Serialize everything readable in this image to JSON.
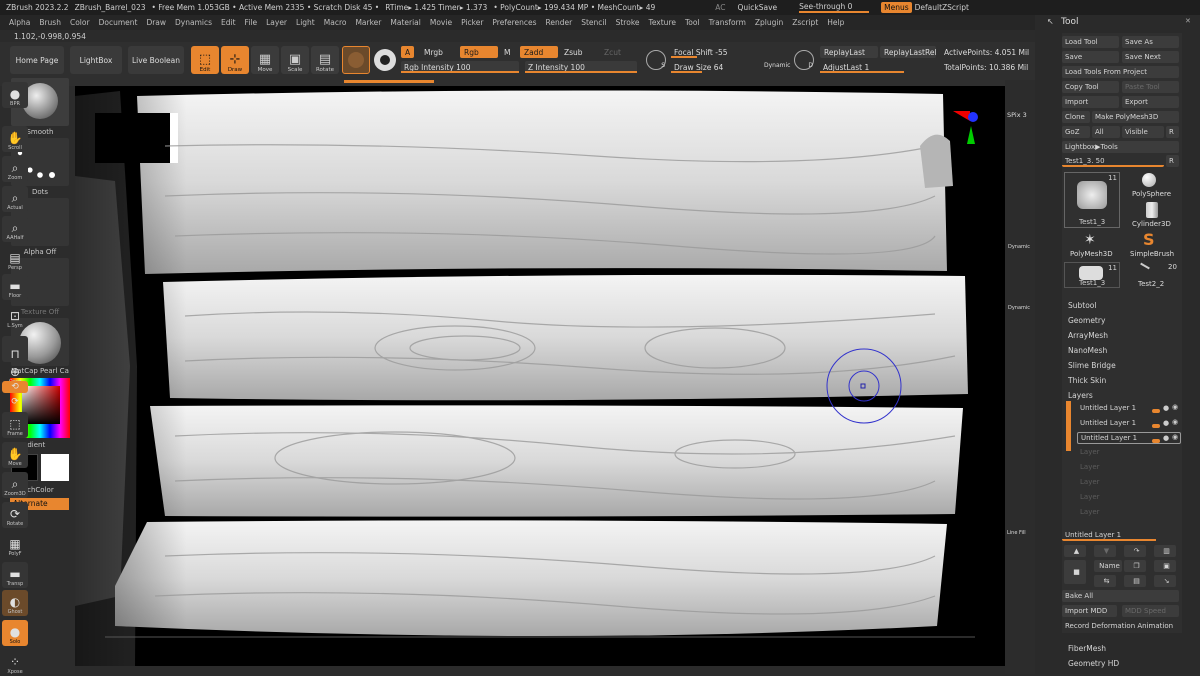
{
  "titlebar": {
    "app": "ZBrush 2023.2.2",
    "file": "ZBrush_Barrel_023",
    "mem": "• Free Mem 1.053GB • Active Mem 2335 • Scratch Disk 45 •",
    "rtime": "RTime▸ 1.425 Timer▸ 1.373",
    "poly": "• PolyCount▸ 199.434 MP • MeshCount▸ 49",
    "ac": "AC",
    "quicksave": "QuickSave",
    "see_through": "See-through  0",
    "menus": "Menus",
    "script": "DefaultZScript"
  },
  "menus": [
    "Alpha",
    "Brush",
    "Color",
    "Document",
    "Draw",
    "Dynamics",
    "Edit",
    "File",
    "Layer",
    "Light",
    "Macro",
    "Marker",
    "Material",
    "Movie",
    "Picker",
    "Preferences",
    "Render",
    "Stencil",
    "Stroke",
    "Texture",
    "Tool",
    "Transform",
    "Zplugin",
    "Zscript",
    "Help"
  ],
  "coords": "1.102,-0.998,0.954",
  "shelf": {
    "home": "Home Page",
    "lightbox": "LightBox",
    "liveboolean": "Live Boolean",
    "edit": "Edit",
    "draw": "Draw",
    "move": "Move",
    "scale": "Scale",
    "rotate": "Rotate",
    "a": "A",
    "mrgb": "Mrgb",
    "rgb": "Rgb",
    "m": "M",
    "zadd": "Zadd",
    "zsub": "Zsub",
    "zcut": "Zcut",
    "rgb_intensity": "Rgb Intensity 100",
    "z_intensity": "Z Intensity 100",
    "focal_shift": "Focal Shift -55",
    "draw_size": "Draw Size 64",
    "dynamic": "Dynamic",
    "replay_last": "ReplayLast",
    "replay_last_rel": "ReplayLastRel",
    "adjust_last": "AdjustLast 1",
    "active_points": "ActivePoints: 4.051 Mil",
    "total_points": "TotalPoints: 10.386 Mil",
    "s_label": "S",
    "d_label": "D"
  },
  "leftpanel": {
    "smooth": "Smooth",
    "dots": "Dots",
    "alpha": "Alpha Off",
    "texture": "Texture Off",
    "matcap": "MatCap Pearl Ca",
    "gradient": "Gradient",
    "switchcolor": "SwitchColor",
    "alternate": "Alternate"
  },
  "rightshelf": {
    "bpr": "BPR",
    "spix": "SPix 3",
    "scroll": "Scroll",
    "zoom": "Zoom",
    "actual": "Actual",
    "aahalf": "AAHalf",
    "dynamic": "Dynamic",
    "persp": "Persp",
    "floor": "Floor",
    "dynamic2": "Dynamic",
    "l_sym": "L.Sym",
    "xyz": "Qxyz",
    "frame": "Frame",
    "move": "Move",
    "zoom3d": "Zoom3D",
    "rotate": "Rotate",
    "linefill": "Line Fill",
    "polyf": "PolyF",
    "transp": "Transp",
    "ghost": "Ghost",
    "solo": "Solo",
    "xpose": "Xpose"
  },
  "toolpanel": {
    "title": "Tool",
    "load_tool": "Load Tool",
    "save_as": "Save As",
    "save": "Save",
    "save_next": "Save Next",
    "load_from_project": "Load Tools From Project",
    "copy_tool": "Copy Tool",
    "paste_tool": "Paste Tool",
    "import": "Import",
    "export": "Export",
    "clone": "Clone",
    "make_polymesh": "Make PolyMesh3D",
    "goz": "GoZ",
    "all": "All",
    "visible": "Visible",
    "r": "R",
    "lightbox_tools": "Lightbox▶Tools",
    "current_tool": "Test1_3. 50",
    "r2": "R",
    "thumbs": [
      {
        "label": "Test1_3",
        "count": "11"
      },
      {
        "label": "PolySphere"
      },
      {
        "label": "Cylinder3D"
      },
      {
        "label": "PolyMesh3D"
      },
      {
        "label": "SimpleBrush"
      },
      {
        "label": "Test1_3",
        "count": "11"
      },
      {
        "label": "Test2_2",
        "count": "20"
      }
    ],
    "sections": [
      "Subtool",
      "Geometry",
      "ArrayMesh",
      "NanoMesh",
      "Slime Bridge",
      "Thick Skin",
      "Layers"
    ],
    "layers": [
      "Untitled Layer 1",
      "Untitled Layer 1",
      "Untitled Layer 1"
    ],
    "empty_layers": [
      "Layer",
      "Layer",
      "Layer",
      "Layer",
      "Layer"
    ],
    "layer_name": "Untitled Layer 1",
    "name_btn": "Name",
    "bake_all": "Bake All",
    "import_mdd": "Import MDD",
    "mdd_speed": "MDD Speed",
    "record": "Record Deformation Animation",
    "fibermesh": "FiberMesh",
    "geometry_hd": "Geometry HD"
  },
  "colors": {
    "accent": "#e8862f",
    "bg": "#2b2b2b"
  }
}
